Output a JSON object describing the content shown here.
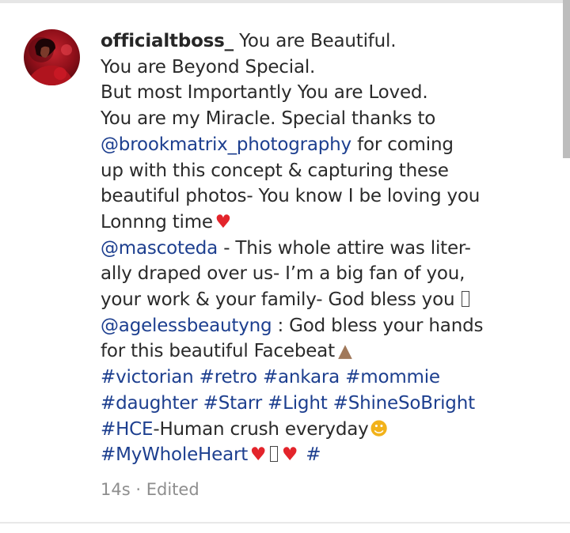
{
  "comment": {
    "username": "officialtboss_",
    "line1_text": "You are Beautiful.",
    "line2_text": "You are Beyond Special.",
    "line3_text": "But most Importantly You are Loved.",
    "line4_text": "You are my Miracle.  Special thanks to",
    "line5_mention": "@brookmatrix_photography",
    "line5_text": "for coming",
    "line6_text": "up with this concept & capturing these",
    "line7_text": "beautiful photos- You know I be loving you",
    "line8_text": "Lonnng time",
    "line9_mention": "@mascoteda",
    "line9_text": "- This whole attire was liter-",
    "line10_text": "ally draped over us- I’m a big fan of you,",
    "line11_text": "your work & your family- God bless you",
    "line12_mention": "@agelessbeautyng",
    "line12_text": ": God bless your hands",
    "line13_text": "for this beautiful Facebeat",
    "line14_tags": "#victorian #retro #ankara #mommie",
    "line15_tags": "#daughter #Starr #Light #ShineSoBright",
    "line16_tag": "#HCE",
    "line16_text": "-Human crush everyday",
    "line17_tag": "#MyWholeHeart",
    "line17_trailing": "#"
  },
  "meta": {
    "timestamp": "14s",
    "separator": "·",
    "status": "Edited"
  },
  "icons": {
    "heart": "heart-emoji",
    "pray": "praying-hands-emoji",
    "laugh": "laughing-face-emoji"
  },
  "colors": {
    "mention": "#1d3f8f",
    "text": "#2a2a2a",
    "meta": "#8e8e8e",
    "heart": "#e3242b"
  }
}
